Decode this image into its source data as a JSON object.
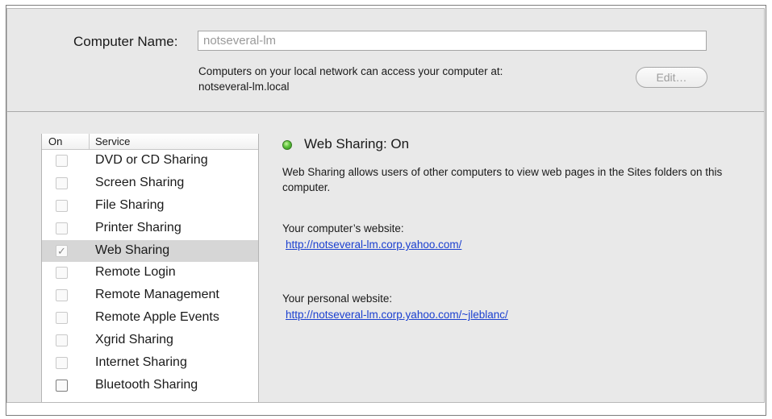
{
  "computer_name": {
    "label": "Computer Name:",
    "value": "notseveral-lm",
    "access_line1": "Computers on your local network can access your computer at:",
    "access_line2": "notseveral-lm.local",
    "edit_label": "Edit…"
  },
  "services": {
    "header_on": "On",
    "header_service": "Service",
    "items": [
      {
        "label": "DVD or CD Sharing",
        "checked": false
      },
      {
        "label": "Screen Sharing",
        "checked": false
      },
      {
        "label": "File Sharing",
        "checked": false
      },
      {
        "label": "Printer Sharing",
        "checked": false
      },
      {
        "label": "Web Sharing",
        "checked": true,
        "selected": true
      },
      {
        "label": "Remote Login",
        "checked": false
      },
      {
        "label": "Remote Management",
        "checked": false
      },
      {
        "label": "Remote Apple Events",
        "checked": false
      },
      {
        "label": "Xgrid Sharing",
        "checked": false
      },
      {
        "label": "Internet Sharing",
        "checked": false
      },
      {
        "label": "Bluetooth Sharing",
        "checked": false
      }
    ]
  },
  "detail": {
    "status_title": "Web Sharing: On",
    "status_color": "#5cc23a",
    "description": "Web Sharing allows users of other computers to view web pages in the Sites folders on this computer.",
    "computer_site_label": "Your computer’s website:",
    "computer_site_url": "http://notseveral-lm.corp.yahoo.com/",
    "personal_site_label": "Your personal website:",
    "personal_site_url": "http://notseveral-lm.corp.yahoo.com/~jleblanc/"
  }
}
